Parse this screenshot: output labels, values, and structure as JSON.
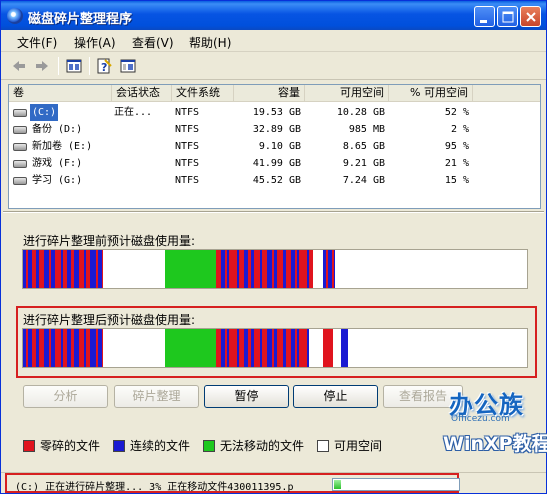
{
  "window": {
    "title": "磁盘碎片整理程序"
  },
  "menu": [
    "文件(F)",
    "操作(A)",
    "查看(V)",
    "帮助(H)"
  ],
  "toolbar": {
    "icons": [
      "back-arrow-icon",
      "forward-arrow-icon",
      "console-tree-icon",
      "help-icon",
      "show-hide-pane-icon"
    ]
  },
  "list": {
    "columns": [
      "卷",
      "会话状态",
      "文件系统",
      "容量",
      "可用空间",
      "% 可用空间"
    ],
    "rows": [
      {
        "volume": "(C:)",
        "status": "正在...",
        "fs": "NTFS",
        "capacity": "19.53 GB",
        "free": "10.28 GB",
        "pct": "52 %"
      },
      {
        "volume": "备份 (D:)",
        "status": "",
        "fs": "NTFS",
        "capacity": "32.89 GB",
        "free": "985 MB",
        "pct": "2 %"
      },
      {
        "volume": "新加卷 (E:)",
        "status": "",
        "fs": "NTFS",
        "capacity": "9.10 GB",
        "free": "8.65 GB",
        "pct": "95 %"
      },
      {
        "volume": "游戏 (F:)",
        "status": "",
        "fs": "NTFS",
        "capacity": "41.99 GB",
        "free": "9.21 GB",
        "pct": "21 %"
      },
      {
        "volume": "学习 (G:)",
        "status": "",
        "fs": "NTFS",
        "capacity": "45.52 GB",
        "free": "7.24 GB",
        "pct": "15 %"
      }
    ]
  },
  "before_label": "进行碎片整理前预计磁盘使用量:",
  "after_label": "进行碎片整理后预计磁盘使用量:",
  "buttons": {
    "analyze": "分析",
    "defrag": "碎片整理",
    "pause": "暂停",
    "stop": "停止",
    "report": "查看报告"
  },
  "legend": {
    "fragmented": "零碎的文件",
    "contiguous": "连续的文件",
    "unmovable": "无法移动的文件",
    "free": "可用空间"
  },
  "status": {
    "text": "(C:) 正在进行碎片整理...  3%  正在移动文件430011395.p",
    "progress_fraction": 0.03
  },
  "watermark": {
    "logo": "办公族",
    "site": "Officezu.com",
    "tagline": "WinXP教程"
  },
  "colors": {
    "fragmented": "#e0141e",
    "contiguous": "#1a1ad2",
    "unmovable": "#1ec81e",
    "free": "#ffffff",
    "title_blue": "#0754e3",
    "highlight_red": "#d62020"
  }
}
